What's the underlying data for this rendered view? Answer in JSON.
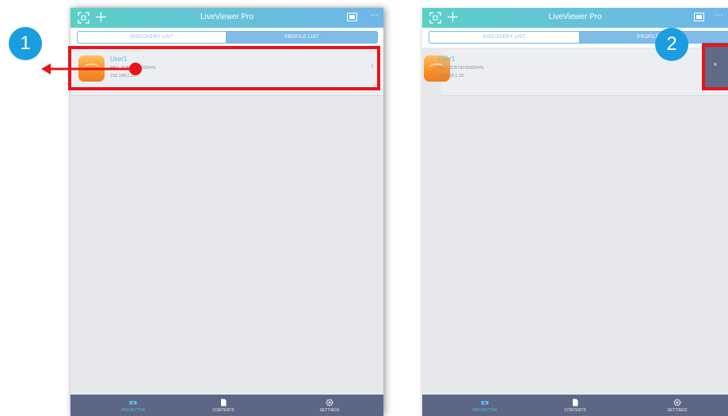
{
  "app": {
    "title": "LiveViewer Pro"
  },
  "segments": {
    "discovery": "DISCOVERY LIST",
    "profile": "PROFILE LIST"
  },
  "device_row": {
    "name": "User1",
    "id": "PRJ_3CB7922000D4%",
    "ip": "192.168.1.23"
  },
  "delete_label": "×",
  "tabs": [
    {
      "label": "PROJECTOR",
      "icon": "projector-icon",
      "active": true
    },
    {
      "label": "CONTENTS",
      "icon": "document-icon",
      "active": false
    },
    {
      "label": "SETTINGS",
      "icon": "gear-icon",
      "active": false
    }
  ],
  "callouts": {
    "step1": "1",
    "step2": "2"
  },
  "colors": {
    "header_start": "#5bcfc6",
    "header_end": "#6fb6ea",
    "highlight": "#e8141a",
    "callout": "#1a9ee0",
    "tabbar": "#5b6784",
    "delete_button": "#5e6a88"
  }
}
